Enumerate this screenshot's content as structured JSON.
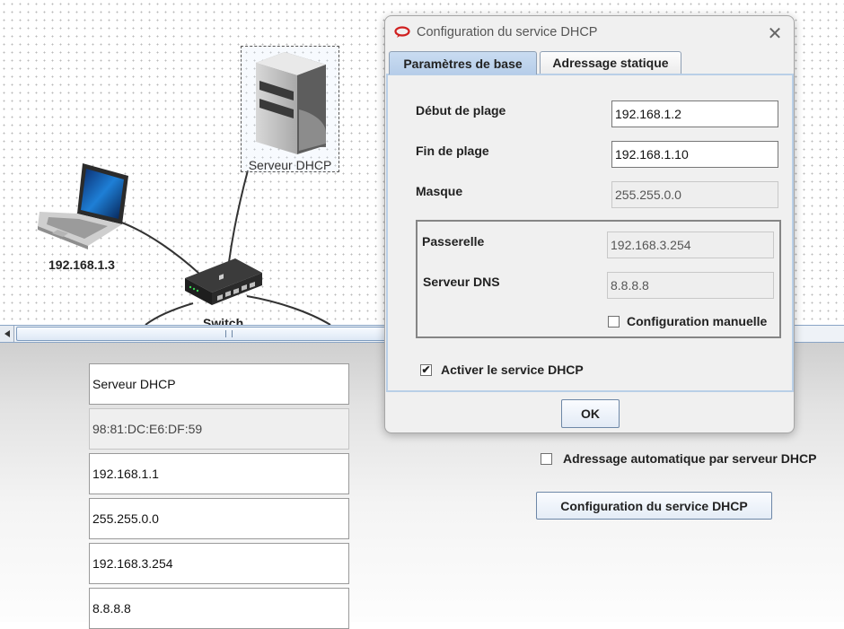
{
  "network": {
    "server_label": "Serveur DHCP",
    "laptop_label": "192.168.1.3",
    "switch_label": "Switch"
  },
  "properties": {
    "fields": [
      {
        "name": "name",
        "value": "Serveur DHCP",
        "readonly": false
      },
      {
        "name": "mac",
        "value": "98:81:DC:E6:DF:59",
        "readonly": true
      },
      {
        "name": "ip",
        "value": "192.168.1.1",
        "readonly": false
      },
      {
        "name": "mask",
        "value": "255.255.0.0",
        "readonly": false
      },
      {
        "name": "gateway",
        "value": "192.168.3.254",
        "readonly": false
      },
      {
        "name": "dns",
        "value": "8.8.8.8",
        "readonly": false
      }
    ],
    "auto_dhcp_label": "Adressage automatique par serveur DHCP",
    "auto_dhcp_checked": false,
    "config_button_label": "Configuration du service DHCP"
  },
  "dialog": {
    "title": "Configuration du service DHCP",
    "tabs": [
      {
        "label": "Paramètres de base",
        "active": true
      },
      {
        "label": "Adressage statique",
        "active": false
      }
    ],
    "range_start_label": "Début de plage",
    "range_start_value": "192.168.1.2",
    "range_end_label": "Fin de plage",
    "range_end_value": "192.168.1.10",
    "mask_label": "Masque",
    "mask_value": "255.255.0.0",
    "gateway_label": "Passerelle",
    "gateway_value": "192.168.3.254",
    "dns_label": "Serveur DNS",
    "dns_value": "8.8.8.8",
    "manual_config_label": "Configuration manuelle",
    "manual_config_checked": false,
    "activate_label": "Activer le service DHCP",
    "activate_checked": true,
    "ok_label": "OK",
    "close_glyph": "✕",
    "check_glyph": "✔",
    "icons": {
      "app": "app-logo-icon",
      "close": "close-icon"
    },
    "accent_color": "#b6cde9"
  }
}
